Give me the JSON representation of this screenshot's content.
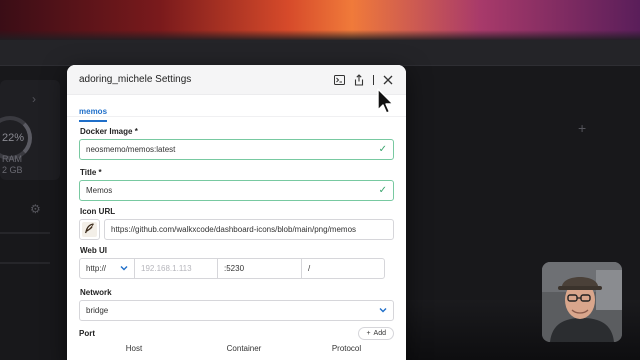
{
  "dialog": {
    "title": "adoring_michele Settings",
    "tab": "memos",
    "docker_image": {
      "label": "Docker Image *",
      "value": "neosmemo/memos:latest"
    },
    "title_field": {
      "label": "Title *",
      "value": "Memos"
    },
    "icon_url": {
      "label": "Icon URL",
      "value": "https://github.com/walkxcode/dashboard-icons/blob/main/png/memos"
    },
    "web_ui": {
      "label": "Web UI",
      "protocol": "http://",
      "host_placeholder": "192.168.1.113",
      "port": ":5230",
      "path": "/"
    },
    "network": {
      "label": "Network",
      "value": "bridge"
    },
    "port": {
      "label": "Port",
      "add_label": "Add",
      "columns": [
        "Host",
        "Container",
        "Protocol"
      ]
    }
  },
  "background": {
    "ring_percent": "22%",
    "ram_label": "RAM",
    "ram_value": "2 GB"
  },
  "icons": {
    "terminal": "terminal-icon",
    "share": "share-icon",
    "close": "close-icon",
    "check": "check-icon",
    "chevron": "chevron-down-icon",
    "add": "plus-icon",
    "app_icon": "memos-feather-icon"
  },
  "colors": {
    "accent": "#1f6fc9",
    "valid": "#3aa56e"
  }
}
